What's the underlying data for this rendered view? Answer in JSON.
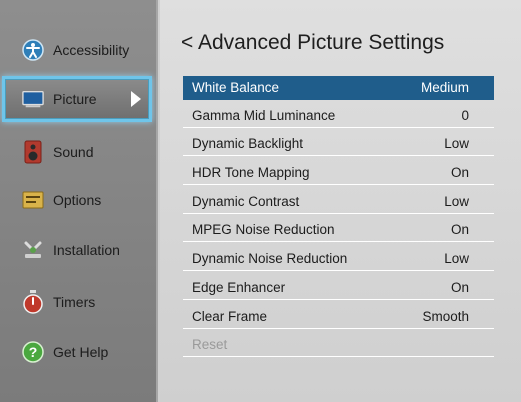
{
  "colors": {
    "sidebar_bg": "#7f7f7f",
    "panel_bg": "#d6d6d6",
    "selected_row": "#1f5d8b",
    "selected_border": "#6fc5ea"
  },
  "sidebar": {
    "items": [
      {
        "label": "Accessibility",
        "icon": "accessibility-icon"
      },
      {
        "label": "Picture",
        "icon": "picture-icon"
      },
      {
        "label": "Sound",
        "icon": "speaker-icon"
      },
      {
        "label": "Options",
        "icon": "options-icon"
      },
      {
        "label": "Installation",
        "icon": "installation-icon"
      },
      {
        "label": "Timers",
        "icon": "timer-icon"
      },
      {
        "label": "Get Help",
        "icon": "help-icon"
      }
    ]
  },
  "panel": {
    "title": "< Advanced Picture Settings",
    "rows": [
      {
        "label": "White Balance",
        "value": "Medium"
      },
      {
        "label": "Gamma Mid Luminance",
        "value": "0"
      },
      {
        "label": "Dynamic Backlight",
        "value": "Low"
      },
      {
        "label": "HDR Tone Mapping",
        "value": "On"
      },
      {
        "label": "Dynamic Contrast",
        "value": "Low"
      },
      {
        "label": "MPEG Noise Reduction",
        "value": "On"
      },
      {
        "label": "Dynamic Noise Reduction",
        "value": "Low"
      },
      {
        "label": "Edge Enhancer",
        "value": "On"
      },
      {
        "label": "Clear Frame",
        "value": "Smooth"
      },
      {
        "label": "Reset",
        "value": ""
      }
    ]
  }
}
